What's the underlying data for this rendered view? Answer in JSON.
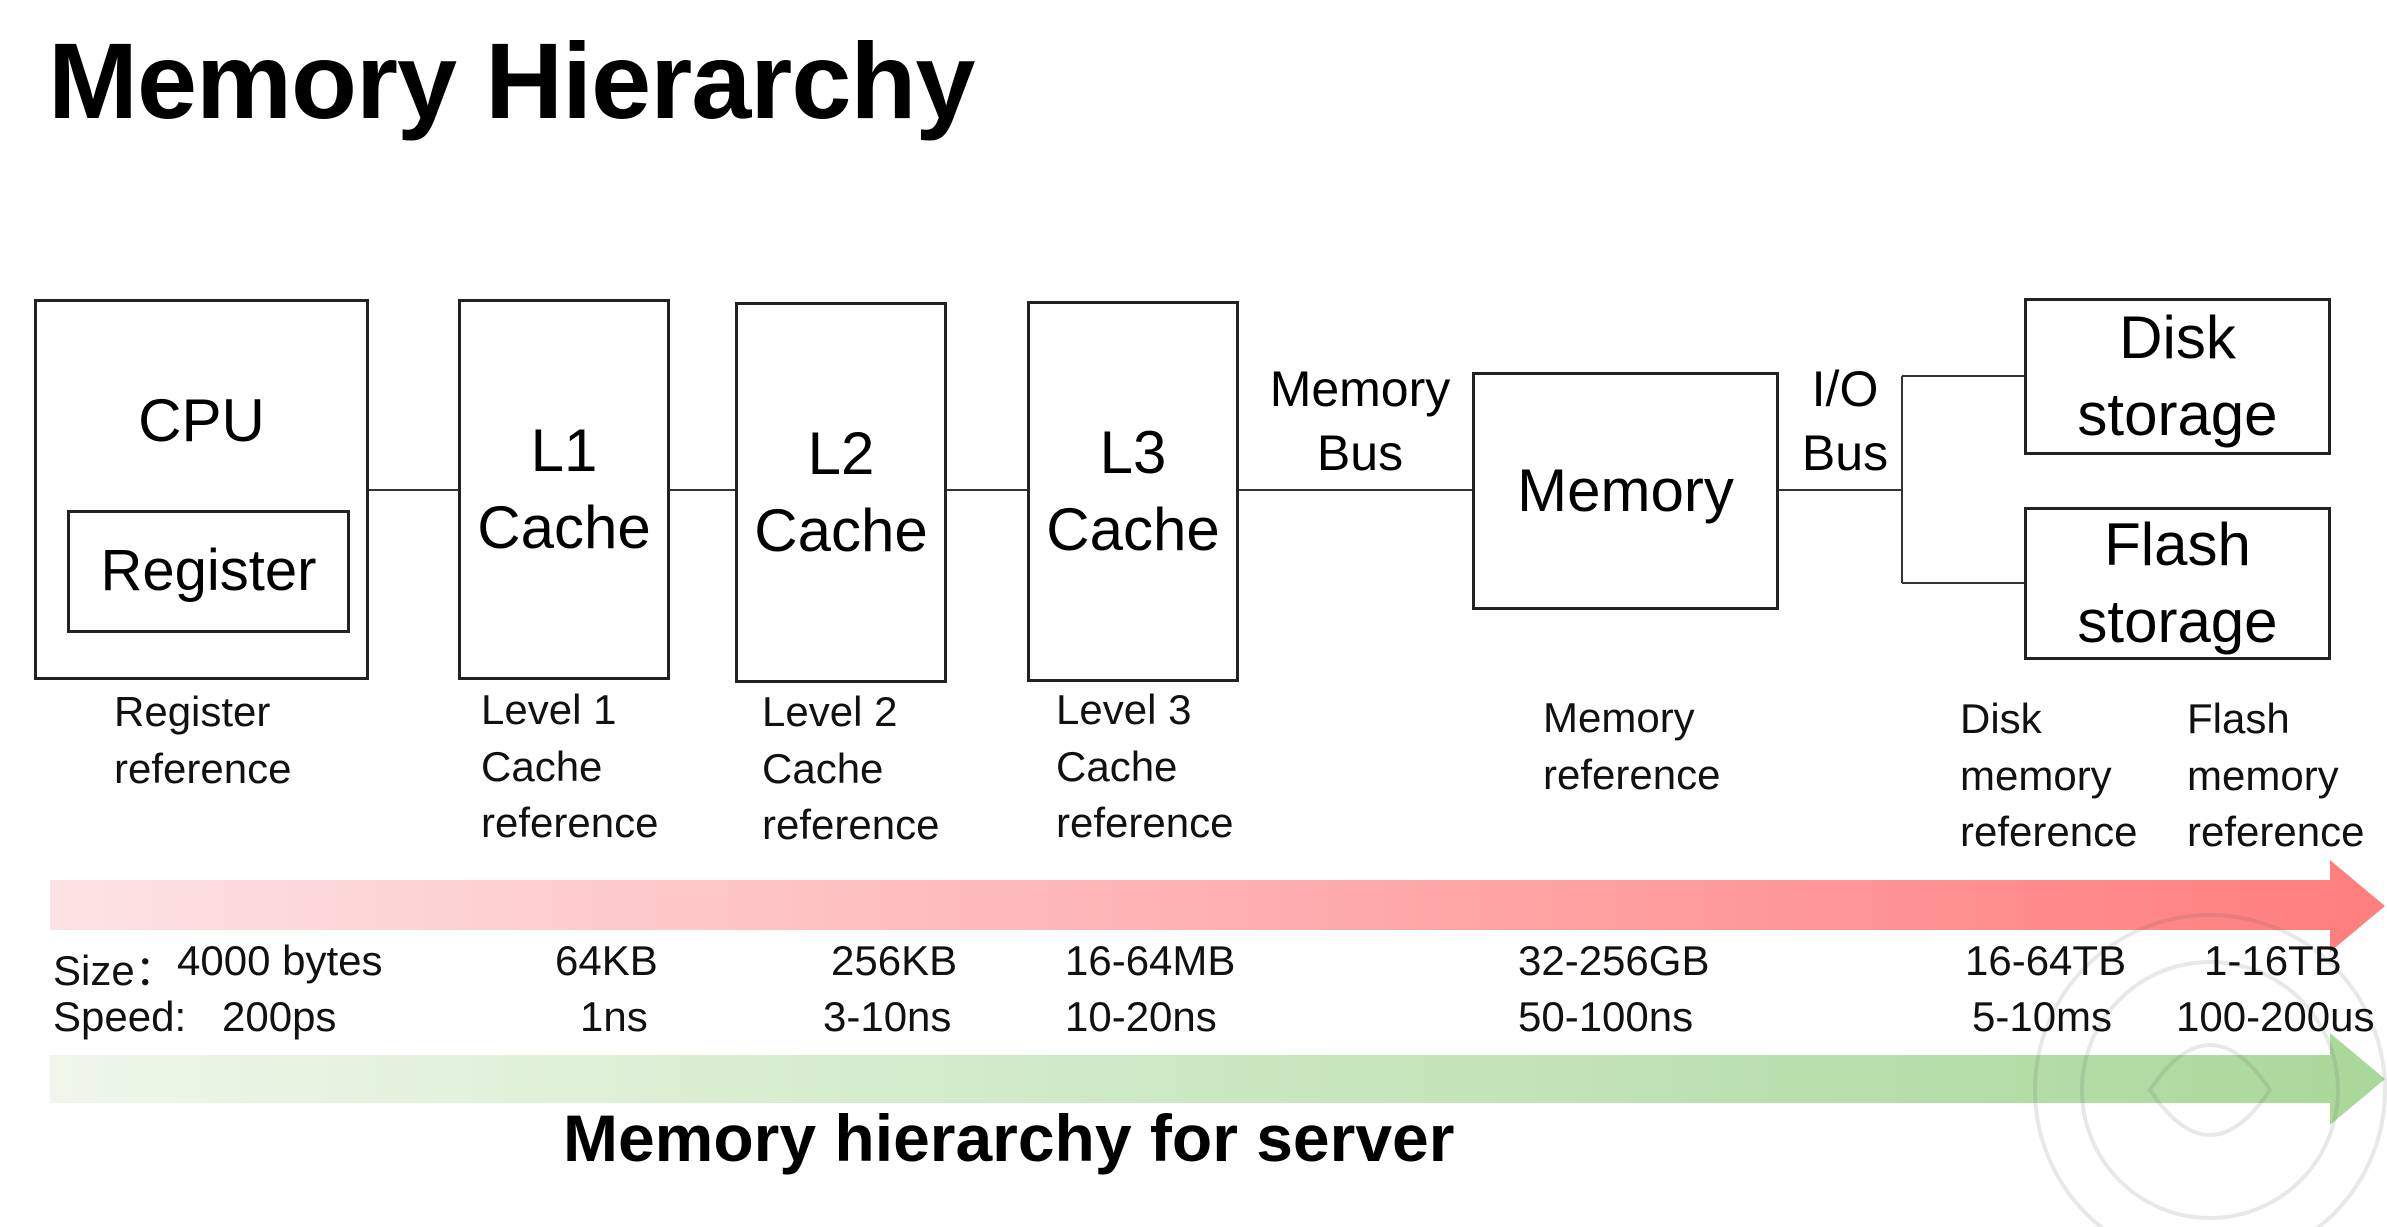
{
  "title": "Memory Hierarchy",
  "components": {
    "cpu": "CPU",
    "register": "Register",
    "l1": "L1\nCache",
    "l2": "L2\nCache",
    "l3": "L3\nCache",
    "memory": "Memory",
    "disk": "Disk\nstorage",
    "flash": "Flash\nstorage"
  },
  "buses": {
    "memory_bus": "Memory\nBus",
    "io_bus": "I/O\nBus"
  },
  "references": {
    "register": "Register\nreference",
    "l1": "Level 1\nCache\nreference",
    "l2": "Level 2\nCache\nreference",
    "l3": "Level 3\nCache\nreference",
    "memory": "Memory\nreference",
    "disk": "Disk\nmemory\nreference",
    "flash": "Flash\nmemory\nreference"
  },
  "sizes": {
    "label": "Size：",
    "register": "4000 bytes",
    "l1": "64KB",
    "l2": "256KB",
    "l3": "16-64MB",
    "memory": "32-256GB",
    "disk": "16-64TB",
    "flash": "1-16TB"
  },
  "speeds": {
    "label": "Speed:",
    "register": "200ps",
    "l1": "1ns",
    "l2": "3-10ns",
    "l3": "10-20ns",
    "memory": "50-100ns",
    "disk": "5-10ms",
    "flash": "100-200us"
  },
  "footer": "Memory hierarchy for server",
  "colors": {
    "size_arrow_start": "#fde3e5",
    "size_arrow_end": "#ff7d7d",
    "speed_arrow_start": "#eef7ea",
    "speed_arrow_end": "#a9d89a"
  }
}
